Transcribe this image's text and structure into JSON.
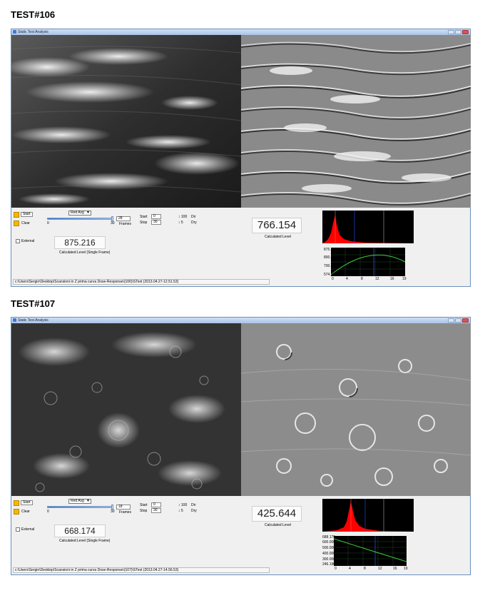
{
  "window_title": "Static Test Analysis",
  "common": {
    "start_label": "Start",
    "clear_label": "Clear",
    "external_label": "External",
    "frames_label": "Frames",
    "combo_value": "Red Avg",
    "slider_min": "0",
    "slider_max": "30",
    "start_field_label": "Start",
    "stop_field_label": "Stop",
    "start_value": "0",
    "stop_value": "30",
    "up_label": "100",
    "down_label": "5",
    "dir_label": "Dir",
    "dry_label": "Dry",
    "calc_level_label": "Calculated Level",
    "calc_level_single_label": "Calculated Level (Single Frame)"
  },
  "tests": [
    {
      "heading": "TEST#106",
      "frames_value": "28",
      "calculated_level": "766.154",
      "single_frame_level": "875.216",
      "path": "c:\\Users\\Sergio\\Desktop\\Scansioni in Z prima curva Dose-Response\\(106)\\STest (2013.04.27-12.51.53)",
      "curve_y_labels": [
        "875.216",
        "800.000",
        "700.000",
        "574.100"
      ],
      "curve_x_labels": [
        "0",
        "4",
        "8",
        "12",
        "16",
        "19"
      ]
    },
    {
      "heading": "TEST#107",
      "frames_value": "18",
      "calculated_level": "425.644",
      "single_frame_level": "668.174",
      "path": "c:\\Users\\Sergio\\Desktop\\Scansioni in Z prima curva Dose-Response\\(107)\\STest (2013.04.27-14.56.53)",
      "curve_y_labels": [
        "688.179",
        "600.000",
        "500.000",
        "400.000",
        "300.000",
        "246.1900"
      ],
      "curve_x_labels": [
        "0",
        "4",
        "8",
        "12",
        "16",
        "19"
      ]
    }
  ],
  "colors": {
    "accent_button": "#f5b800",
    "histogram_fill": "#ff0000",
    "curve": "#3cc83c",
    "marker": "#2255ff"
  }
}
